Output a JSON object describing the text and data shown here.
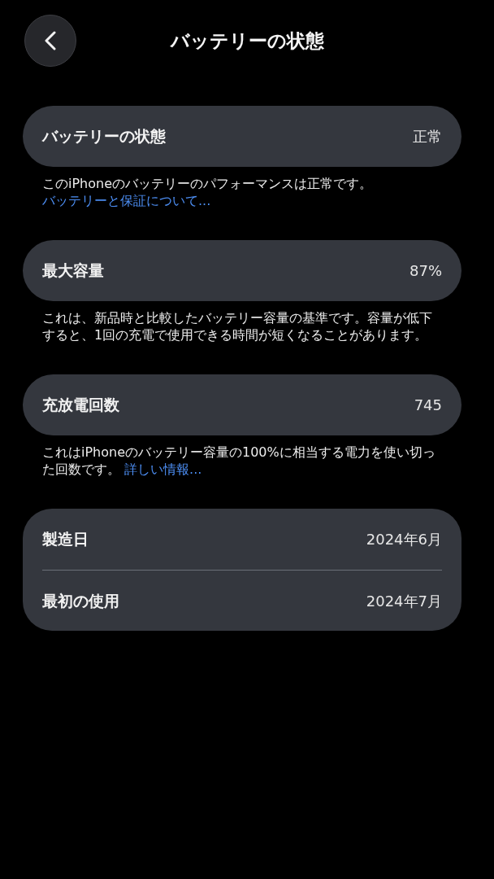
{
  "nav": {
    "title": "バッテリーの状態"
  },
  "sections": [
    {
      "rows": [
        {
          "label": "バッテリーの状態",
          "value": "正常"
        }
      ],
      "footer": {
        "text": "このiPhoneのバッテリーのパフォーマンスは正常です。",
        "link": "バッテリーと保証について..."
      }
    },
    {
      "rows": [
        {
          "label": "最大容量",
          "value": "87%"
        }
      ],
      "footer": {
        "text": "これは、新品時と比較したバッテリー容量の基準です。容量が低下すると、1回の充電で使用できる時間が短くなることがあります。"
      }
    },
    {
      "rows": [
        {
          "label": "充放電回数",
          "value": "745"
        }
      ],
      "footer": {
        "text": "これはiPhoneのバッテリー容量の100%に相当する電力を使い切った回数です。",
        "link": "詳しい情報..."
      }
    },
    {
      "rows": [
        {
          "label": "製造日",
          "value": "2024年6月"
        },
        {
          "label": "最初の使用",
          "value": "2024年7月"
        }
      ]
    }
  ]
}
